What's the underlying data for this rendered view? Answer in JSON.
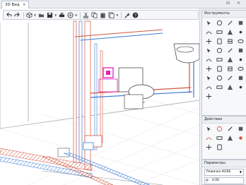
{
  "tab": {
    "label": "3D Вид",
    "close": "✕"
  },
  "window_controls": "⊟ ✕",
  "toolbar": {
    "items": [
      "undo-icon",
      "redo-icon",
      "view-cube-icon",
      "folder-icon",
      "save-icon",
      "print-icon",
      "layers-icon",
      "cut-icon",
      "copy-icon",
      "paste-icon",
      "pages-icon",
      "wrench-icon",
      "help-icon"
    ]
  },
  "panels": {
    "tools": {
      "title": "Инструменты",
      "count": 33
    },
    "actions": {
      "title": "Действия",
      "count": 10
    },
    "params": {
      "title": "Параметры",
      "mode": "Режизон КGRE",
      "value": "0.00"
    }
  },
  "colors": {
    "accent": "#2a6ebb",
    "pipe_red": "#d0553e",
    "pipe_blue": "#3a7bd5",
    "magenta": "#e020c0"
  }
}
